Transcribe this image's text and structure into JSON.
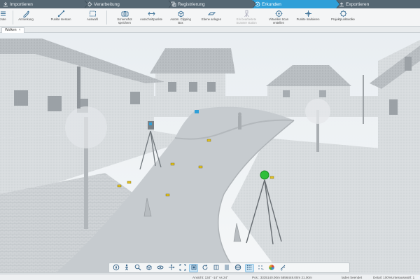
{
  "workflow": {
    "tabs": [
      {
        "label": "Importieren",
        "active": false
      },
      {
        "label": "Verarbeitung",
        "active": false
      },
      {
        "label": "Registrierung",
        "active": false
      },
      {
        "label": "Erkunden",
        "active": true
      },
      {
        "label": "Exportieren",
        "active": false
      }
    ],
    "active_color": "#2f9fd8"
  },
  "ribbon": {
    "items": [
      {
        "label": "orate",
        "icon": "list-icon"
      },
      {
        "label": "Anmerkung",
        "icon": "annotation-icon"
      },
      {
        "label": "Punkte messen",
        "icon": "measure-icon"
      },
      {
        "label": "Auswahl",
        "icon": "select-icon"
      },
      {
        "label": "Screenshot speichern",
        "icon": "camera-icon"
      },
      {
        "label": "Ausschnittpunkte",
        "icon": "clip-points-icon"
      },
      {
        "label": "Autom. Clipping Box",
        "icon": "clipping-box-icon"
      },
      {
        "label": "Ebene anlegen",
        "icon": "plane-icon"
      },
      {
        "label": "Ein bearbeitete Scanner station",
        "icon": "scanner-station-icon",
        "disabled": true
      },
      {
        "label": "Virtuellen Scan erstellen",
        "icon": "virtual-scan-icon"
      },
      {
        "label": "Punkte markieren",
        "icon": "mark-points-icon"
      },
      {
        "label": "Projektpunktwolke",
        "icon": "point-cloud-icon"
      }
    ]
  },
  "document": {
    "tab_label": "Wolken",
    "close_label": "×"
  },
  "viewport_toolbar": {
    "tools": [
      {
        "icon": "navigate-icon",
        "active": false
      },
      {
        "icon": "walk-icon",
        "active": false
      },
      {
        "icon": "zoom-icon",
        "active": false
      },
      {
        "icon": "view-cube-icon",
        "active": false
      },
      {
        "icon": "orbit-icon",
        "active": false
      },
      {
        "icon": "pan-icon",
        "active": false
      },
      {
        "icon": "fit-icon",
        "active": false
      },
      {
        "icon": "box-view-icon",
        "active": true
      },
      {
        "icon": "rotate-view-icon",
        "active": false
      },
      {
        "icon": "slice-icon",
        "active": false
      },
      {
        "icon": "section-icon",
        "active": false
      },
      {
        "icon": "globe-view-icon",
        "active": false
      },
      {
        "icon": "points-density-icon",
        "active": true
      },
      {
        "icon": "grid-dots-icon",
        "active": false
      },
      {
        "icon": "color-mode-icon",
        "active": false
      },
      {
        "icon": "measure-tool-icon",
        "active": false
      }
    ]
  },
  "status": {
    "view": "Ansicht: 134° -14° vs 24°",
    "position": "Pos.: 3335140.00m 5856448.00m 21.00m",
    "loading": "laden beendet",
    "detail": "Detail: 100%",
    "subsample": "Unterauswahl: 1"
  }
}
